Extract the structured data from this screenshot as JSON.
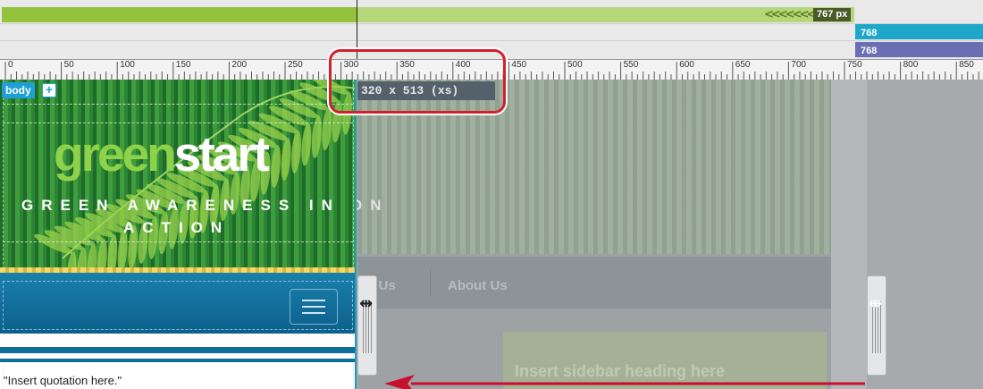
{
  "media_queries": {
    "max_767": {
      "label": "767 px",
      "color": "#95c23d"
    },
    "min_768_cyan": {
      "label": "768 px",
      "color": "#1da8c9"
    },
    "min_768_blue": {
      "label": "768 px",
      "color": "#6a6fb3"
    }
  },
  "ruler": {
    "ticks": [
      "0",
      "50",
      "100",
      "150",
      "200",
      "250",
      "300",
      "350",
      "400",
      "450",
      "500",
      "550",
      "600",
      "650",
      "700",
      "750",
      "800",
      "850"
    ]
  },
  "design_view": {
    "body_tag": "body",
    "body_tag_add": "+",
    "viewport_size": "320 x 513 (xs)",
    "logo_part1": "green",
    "logo_part2": "start",
    "tagline_line1": "GREEN AWARENESS IN",
    "tagline_line2": "ACTION",
    "tagline_tail_behind": "ON",
    "nav_behind": [
      "ct Us",
      "About Us"
    ],
    "sidebar_heading_behind": "Insert sidebar heading here",
    "quotation": "\"Insert quotation here.\""
  },
  "colors": {
    "accent_callout": "#d4202e",
    "selection_border": "#1f9bbd",
    "body_tag_bg": "#1ea0d6"
  }
}
